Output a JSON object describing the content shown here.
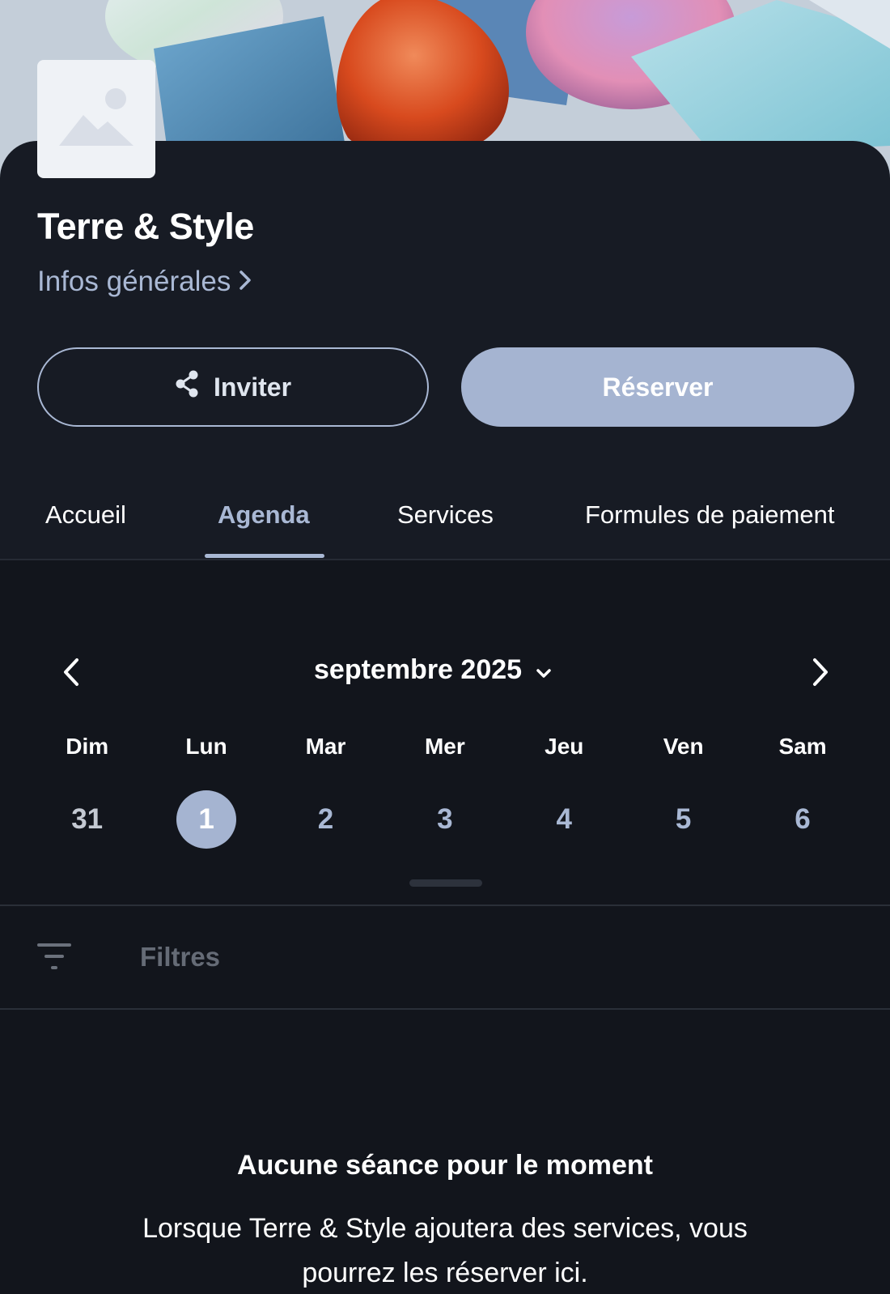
{
  "header": {
    "title": "Terre & Style",
    "info_link": "Infos générales",
    "logo_icon": "image-placeholder-icon"
  },
  "actions": {
    "invite_label": "Inviter",
    "invite_icon": "share-icon",
    "book_label": "Réserver"
  },
  "tabs": [
    {
      "label": "Accueil",
      "active": false
    },
    {
      "label": "Agenda",
      "active": true
    },
    {
      "label": "Services",
      "active": false
    },
    {
      "label": "Formules de paiement",
      "active": false
    }
  ],
  "calendar": {
    "month_label": "septembre 2025",
    "weekdays": [
      "Dim",
      "Lun",
      "Mar",
      "Mer",
      "Jeu",
      "Ven",
      "Sam"
    ],
    "days": [
      "31",
      "1",
      "2",
      "3",
      "4",
      "5",
      "6"
    ],
    "selected_day": "1"
  },
  "filters": {
    "label": "Filtres",
    "icon": "filter-icon"
  },
  "empty_state": {
    "title": "Aucune séance pour le moment",
    "body": "Lorsque Terre & Style ajoutera des services, vous pourrez les réserver ici."
  },
  "colors": {
    "background": "#12151c",
    "card": "#171b24",
    "accent": "#a5b4d1",
    "link": "#a9b8d4"
  }
}
